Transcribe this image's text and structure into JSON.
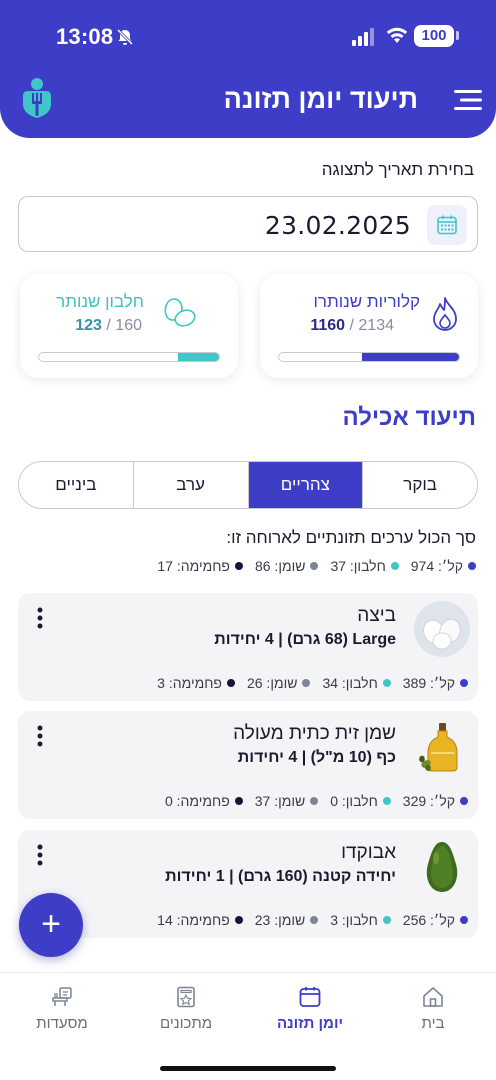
{
  "status": {
    "time": "13:08",
    "battery": "100"
  },
  "header": {
    "title": "תיעוד יומן תזונה"
  },
  "date": {
    "label": "בחירת תאריך לתצוגה",
    "value": "23.02.2025"
  },
  "stats": {
    "calories": {
      "title": "קלוריות שנותרו",
      "remaining": "1160",
      "separator": " / ",
      "total": "2134",
      "fraction": 0.54
    },
    "protein": {
      "title": "חלבון שנותר",
      "remaining": "123",
      "separator": " / ",
      "total": "160",
      "fraction": 0.23
    }
  },
  "section_title": "תיעוד אכילה",
  "tabs": [
    {
      "label": "בוקר",
      "active": false
    },
    {
      "label": "צהריים",
      "active": true
    },
    {
      "label": "ערב",
      "active": false
    },
    {
      "label": "ביניים",
      "active": false
    }
  ],
  "summary": {
    "label": "סך הכול ערכים תזונתיים לארוחה זו:",
    "cal": "קל׳: 974",
    "prot": "חלבון: 37",
    "fat": "שומן: 86",
    "carb": "פחמימה: 17"
  },
  "foods": [
    {
      "name": "ביצה",
      "portion": "Large (68 גרם) | 4 יחידות",
      "cal": "קל׳: 389",
      "prot": "חלבון: 34",
      "fat": "שומן: 26",
      "carb": "פחמימה: 3",
      "icon": "egg-icon"
    },
    {
      "name": "שמן זית כתית מעולה",
      "portion": "כף (10 מ\"ל) | 4 יחידות",
      "cal": "קל׳: 329",
      "prot": "חלבון: 0",
      "fat": "שומן: 37",
      "carb": "פחמימה: 0",
      "icon": "olive-oil-icon"
    },
    {
      "name": "אבוקדו",
      "portion": "יחידה קטנה (160 גרם) | 1 יחידות",
      "cal": "קל׳: 256",
      "prot": "חלבון: 3",
      "fat": "שומן: 23",
      "carb": "פחמימה: 14",
      "icon": "avocado-icon"
    }
  ],
  "fab": {
    "label": "+"
  },
  "nav": [
    {
      "label": "בית",
      "icon": "home-icon",
      "active": false
    },
    {
      "label": "יומן תזונה",
      "icon": "calendar-icon",
      "active": true
    },
    {
      "label": "מתכונים",
      "icon": "recipe-book-icon",
      "active": false
    },
    {
      "label": "מסעדות",
      "icon": "restaurant-icon",
      "active": false
    }
  ],
  "colors": {
    "primary": "#3d3dc7",
    "teal": "#3fc6c6",
    "fat": "#7b8596",
    "carb": "#15153a"
  }
}
